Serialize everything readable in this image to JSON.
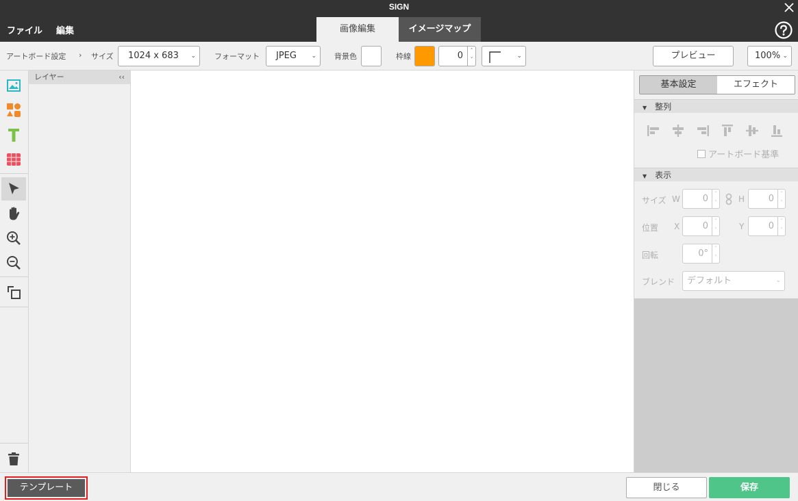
{
  "window": {
    "title": "SIGN"
  },
  "menu": {
    "items": [
      "ファイル",
      "編集"
    ]
  },
  "tabs": [
    {
      "label": "画像編集",
      "active": true
    },
    {
      "label": "イメージマップ",
      "active": false
    }
  ],
  "toolbar": {
    "artboard_label": "アートボード設定",
    "breadcrumb_sep": "›",
    "size_label": "サイズ",
    "size_value": "1024 x 683",
    "format_label": "フォーマット",
    "format_value": "JPEG",
    "bg_label": "背景色",
    "bg_color": "#ffffff",
    "border_label": "枠線",
    "border_color": "#ff9900",
    "border_width": "0",
    "preview_label": "プレビュー",
    "zoom_value": "100%"
  },
  "tools": [
    "image-tool",
    "shape-tool",
    "text-tool",
    "table-tool",
    "select-tool",
    "hand-tool",
    "zoom-in-tool",
    "zoom-out-tool",
    "arrange-tool",
    "trash"
  ],
  "layers": {
    "title": "レイヤー",
    "collapse": "‹‹"
  },
  "props": {
    "tab_basic": "基本設定",
    "tab_effect": "エフェクト",
    "align_title": "整列",
    "artboard_base": "アートボード基準",
    "display_title": "表示",
    "size_label": "サイズ",
    "w_label": "W",
    "w_value": "0",
    "h_label": "H",
    "h_value": "0",
    "pos_label": "位置",
    "x_label": "X",
    "x_value": "0",
    "y_label": "Y",
    "y_value": "0",
    "rot_label": "回転",
    "rot_value": "0°",
    "blend_label": "ブレンド",
    "blend_value": "デフォルト"
  },
  "bottom": {
    "template_label": "テンプレート",
    "close_label": "閉じる",
    "save_label": "保存",
    "save_color": "#4fc58a"
  }
}
